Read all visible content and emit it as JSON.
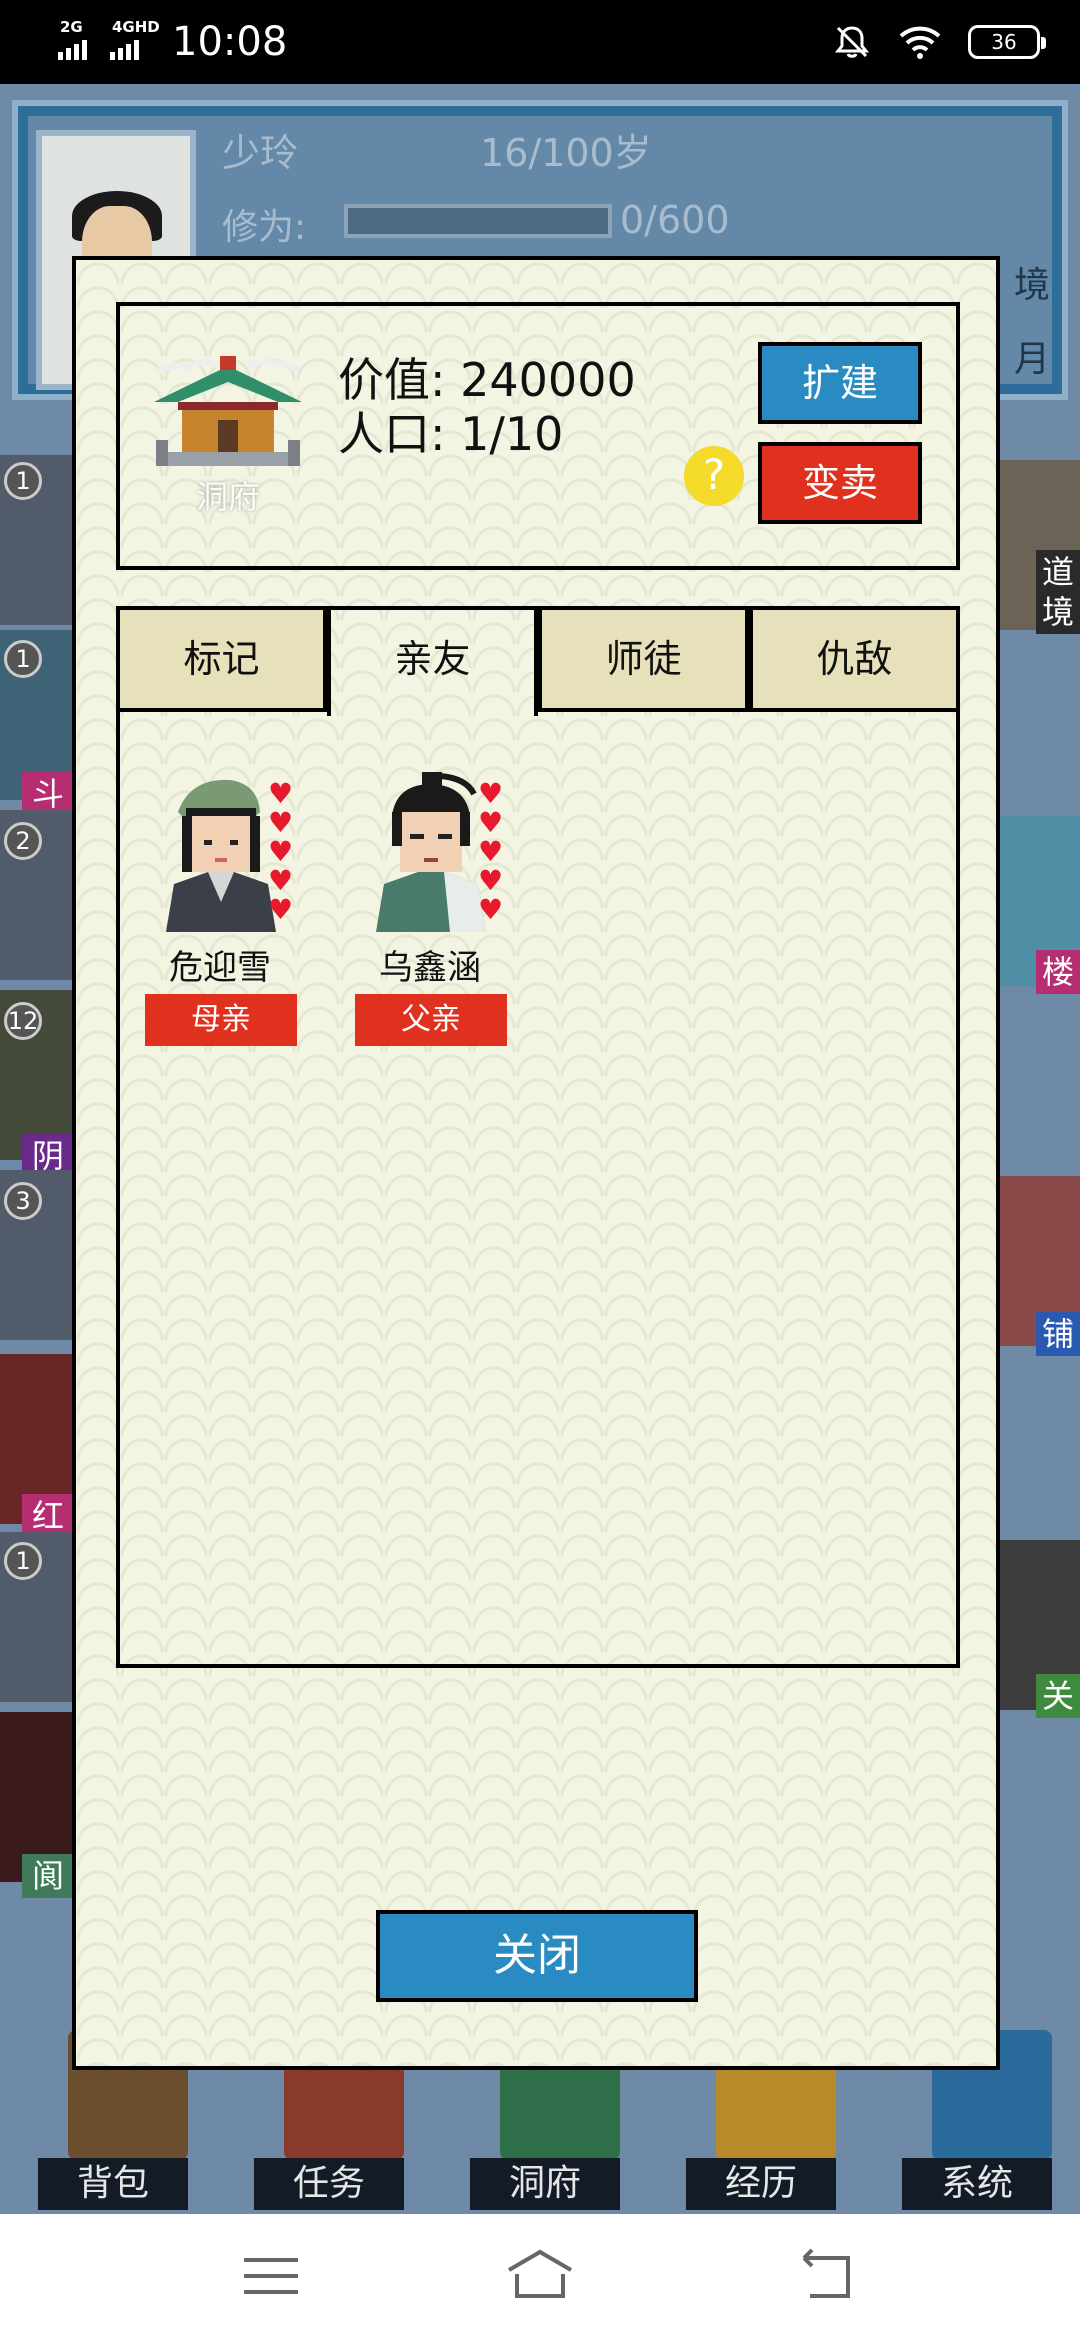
{
  "status_bar": {
    "network_1": "2G",
    "network_2": "4GHD",
    "time": "10:08",
    "battery": "36"
  },
  "background": {
    "character": {
      "name": "少玲",
      "age": "16/100岁",
      "cultivation_label": "修为:",
      "cultivation_value": "0/600",
      "cultivation_fraction": 0,
      "right_text_1": "境",
      "right_text_2": "月"
    },
    "left_tiles": [
      {
        "count": "1",
        "label": ""
      },
      {
        "count": "1",
        "label": "斗"
      },
      {
        "count": "2",
        "label": ""
      },
      {
        "count": "12",
        "label": "阴"
      },
      {
        "count": "3",
        "label": ""
      },
      {
        "count": "",
        "label": "红"
      },
      {
        "count": "1",
        "label": ""
      },
      {
        "count": "",
        "label": "阆"
      }
    ],
    "right_tiles": [
      {
        "label": "道"
      },
      {
        "label": "境"
      },
      {
        "label": "楼"
      },
      {
        "label": "铺"
      },
      {
        "label": "关"
      }
    ],
    "bottom_nav": [
      {
        "label": "背包"
      },
      {
        "label": "任务"
      },
      {
        "label": "洞府"
      },
      {
        "label": "经历"
      },
      {
        "label": "系统"
      }
    ]
  },
  "modal": {
    "residence_label": "洞府",
    "value_label": "价值:",
    "value": "240000",
    "population_label": "人口:",
    "population": "1/10",
    "help_icon_text": "?",
    "expand_button": "扩建",
    "sell_button": "变卖",
    "tabs": [
      {
        "label": "标记",
        "active": false
      },
      {
        "label": "亲友",
        "active": true
      },
      {
        "label": "师徒",
        "active": false
      },
      {
        "label": "仇敌",
        "active": false
      }
    ],
    "friends": [
      {
        "name": "危迎雪",
        "relation": "母亲",
        "hearts": 5
      },
      {
        "name": "乌鑫涵",
        "relation": "父亲",
        "hearts": 5
      }
    ],
    "close_button": "关闭"
  },
  "colors": {
    "accent_blue": "#2a8bc2",
    "accent_red": "#e0301e",
    "modal_bg": "#f3f5e2",
    "tab_inactive": "#e7e1bb"
  }
}
